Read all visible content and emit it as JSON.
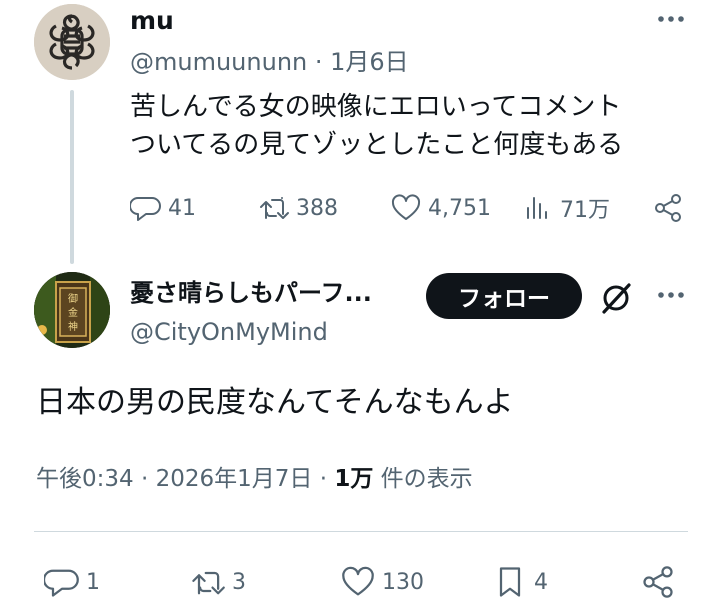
{
  "parent_tweet": {
    "display_name": "mu",
    "handle_date": "@mumuununn · 1月6日",
    "text_line1": "苦しんでる女の映像にエロいってコメント",
    "text_line2": "ついてるの見てゾッとしたこと何度もある",
    "stats": {
      "replies": "41",
      "retweets": "388",
      "likes": "4,751",
      "views": "71万"
    }
  },
  "main_tweet": {
    "display_name": "憂さ晴らしもパーフ...",
    "handle": "@CityOnMyMind",
    "follow_label": "フォロー",
    "text": "日本の男の民度なんてそんなもんよ",
    "meta_time": "午後0:34 · 2026年1月7日 · ",
    "meta_views": "1万",
    "meta_views_suffix": " 件の表示",
    "stats": {
      "replies": "1",
      "retweets": "3",
      "likes": "130",
      "bookmarks": "4"
    }
  },
  "icons": {
    "reply": "reply-icon",
    "retweet": "retweet-icon",
    "like": "heart-icon",
    "views": "views-icon",
    "share": "share-icon",
    "bookmark": "bookmark-icon",
    "more": "more-icon",
    "grok": "grok-icon"
  },
  "colors": {
    "text": "#0f1419",
    "secondary": "#536471",
    "divider": "#cfd9de",
    "follow_bg": "#0f1419"
  }
}
